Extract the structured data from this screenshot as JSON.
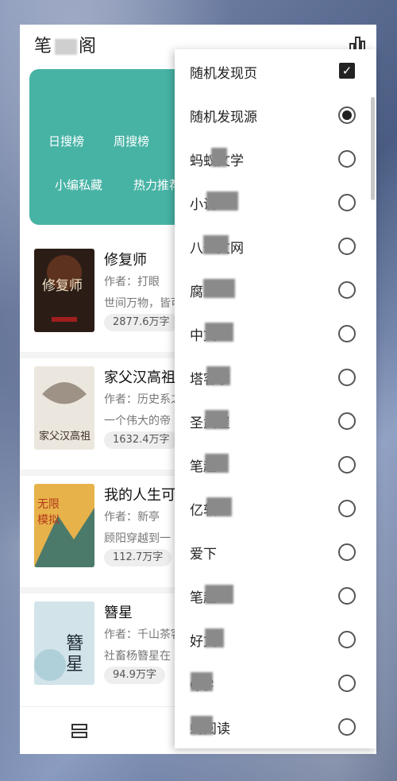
{
  "header": {
    "title_prefix": "笔",
    "title_suffix": "阁",
    "rank_icon": "rank-icon"
  },
  "card_tags": [
    "日搜榜",
    "周搜榜",
    "小编私藏",
    "热力推荐"
  ],
  "books": [
    {
      "title": "修复师",
      "author": "作者：打眼",
      "intro": "世间万物，皆可",
      "words": "2877.6万字",
      "cover_color": "#3a2a20"
    },
    {
      "title": "家父汉高祖",
      "author": "作者：历史系之",
      "intro": "一个伟大的帝",
      "words": "1632.4万字",
      "cover_color": "#e9e4dc"
    },
    {
      "title": "我的人生可",
      "author": "作者：新亭",
      "intro": "顾阳穿越到一",
      "words": "112.7万字",
      "cover_color": "#d9a13a"
    },
    {
      "title": "簪星",
      "author": "作者：千山茶客",
      "intro": "社畜杨簪星在",
      "words": "94.9万字",
      "cover_color": "#c9dde6"
    }
  ],
  "menu": {
    "items": [
      {
        "label": "随机发现页",
        "control": "checkbox",
        "checked": true
      },
      {
        "label": "随机发现源",
        "control": "radio",
        "checked": true
      },
      {
        "label": "蚂蚁文学",
        "control": "radio",
        "checked": false
      },
      {
        "label": "小说",
        "control": "radio",
        "checked": false
      },
      {
        "label": "八一文网",
        "control": "radio",
        "checked": false
      },
      {
        "label": "腐",
        "control": "radio",
        "checked": false
      },
      {
        "label": "中文",
        "control": "radio",
        "checked": false
      },
      {
        "label": "塔客学",
        "control": "radio",
        "checked": false
      },
      {
        "label": "圣武屋",
        "control": "radio",
        "checked": false
      },
      {
        "label": "笔趣",
        "control": "radio",
        "checked": false
      },
      {
        "label": "亿软",
        "control": "radio",
        "checked": false
      },
      {
        "label": "爱下",
        "control": "radio",
        "checked": false
      },
      {
        "label": "笔趣",
        "control": "radio",
        "checked": false
      },
      {
        "label": "好文",
        "control": "radio",
        "checked": false
      },
      {
        "label": "Q学",
        "control": "radio",
        "checked": false
      },
      {
        "label": "蚂阅读",
        "control": "radio",
        "checked": false
      }
    ]
  },
  "bottom": {
    "shelf_icon": "bookshelf-icon"
  }
}
